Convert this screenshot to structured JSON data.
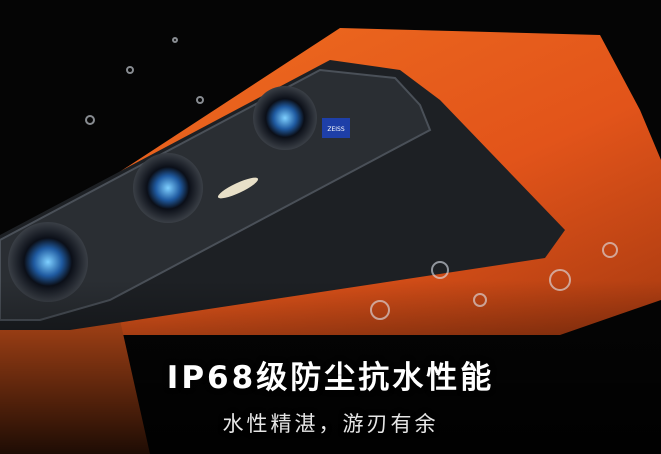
{
  "headline": "IP68级防尘抗水性能",
  "subline": "水性精湛，游刃有余",
  "camera_badge": "ZEISS",
  "colors": {
    "body_orange": "#e8581a",
    "glass": "#1d2024",
    "background": "#050505"
  }
}
